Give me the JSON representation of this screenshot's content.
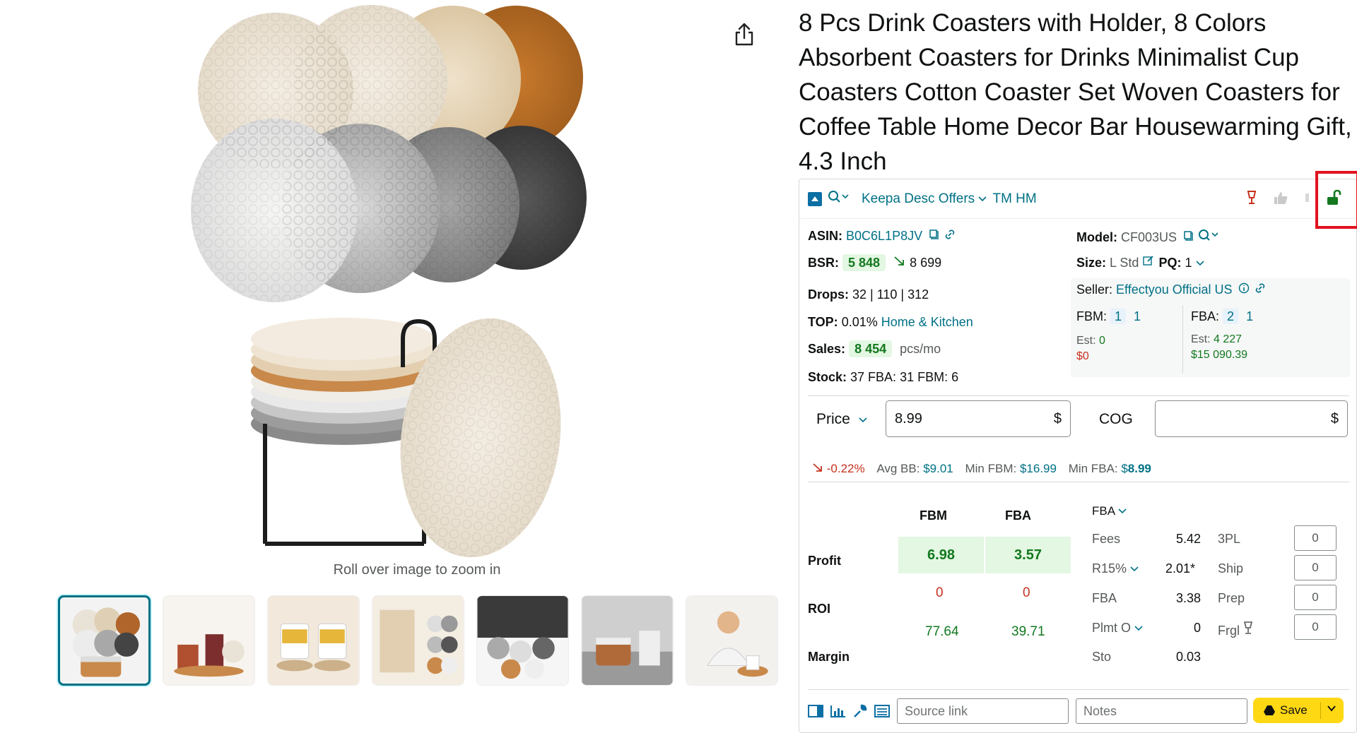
{
  "gallery": {
    "zoom_hint": "Roll over image to zoom in",
    "thumbnail_count": 7
  },
  "product": {
    "title": "8 Pcs Drink Coasters with Holder, 8 Colors Absorbent Coasters for Drinks Minimalist Cup Coasters Cotton Coaster Set Woven Coasters for Coffee Table Home Decor Bar Housewarming Gift, 4.3 Inch"
  },
  "keepa": {
    "toolbar": {
      "menu_label": "Keepa Desc Offers",
      "tm_hm": "TM HM"
    },
    "asin_label": "ASIN:",
    "asin": "B0C6L1P8JV",
    "model_label": "Model:",
    "model": "CF003US",
    "bsr_label": "BSR:",
    "bsr": "5 848",
    "bsr_prev": "8 699",
    "size_label": "Size:",
    "size": "L Std",
    "pq_label": "PQ:",
    "pq": "1",
    "drops_label": "Drops:",
    "drops": "32 | 110 | 312",
    "seller_label": "Seller:",
    "seller": "Effectyou Official US",
    "top_label": "TOP:",
    "top_pct": "0.01%",
    "top_category": "Home & Kitchen",
    "fbm_label": "FBM:",
    "fbm_count_a": "1",
    "fbm_count_b": "1",
    "fba_label": "FBA:",
    "fba_count_a": "2",
    "fba_count_b": "1",
    "sales_label": "Sales:",
    "sales": "8 454",
    "sales_unit": "pcs/mo",
    "est_label": "Est:",
    "fbm_est": "0",
    "fbm_est_money": "$0",
    "fba_est": "4 227",
    "fba_est_money": "$15 090.39",
    "stock_label": "Stock:",
    "stock": "37 FBA: 31 FBM: 6",
    "price_label": "Price",
    "price_value": "8.99",
    "currency": "$",
    "cog_label": "COG",
    "cog_value": "",
    "price_change": "-0.22%",
    "avg_bb_label": "Avg BB:",
    "avg_bb": "$9.01",
    "min_fbm_label": "Min FBM:",
    "min_fbm": "$16.99",
    "min_fba_label": "Min FBA:",
    "min_fba_prefix": "$",
    "min_fba": "8.99",
    "col_fbm": "FBM",
    "col_fba": "FBA",
    "profit_label": "Profit",
    "profit_fbm": "6.98",
    "profit_fba": "3.57",
    "roi_label": "ROI",
    "roi_fbm": "0",
    "roi_fba": "0",
    "margin_label": "Margin",
    "margin_fbm": "77.64",
    "margin_fba": "39.71",
    "fee_mode": "FBA",
    "fees": [
      {
        "label": "Fees",
        "value": "5.42",
        "right_label": "3PL",
        "input": "0"
      },
      {
        "label": "R15%",
        "value": "2.01*",
        "right_label": "Ship",
        "input": "0"
      },
      {
        "label": "FBA",
        "value": "3.38",
        "right_label": "Prep",
        "input": "0"
      },
      {
        "label": "Plmt O",
        "value": "0",
        "right_label": "Frgl",
        "input": "0"
      },
      {
        "label": "Sto",
        "value": "0.03"
      }
    ],
    "source_placeholder": "Source link",
    "notes_placeholder": "Notes",
    "save_label": "Save"
  },
  "colors": {
    "link": "#007185",
    "green": "#13781f",
    "red": "#c7321f",
    "highlight_box": "#e1121f",
    "save_button": "#ffd814"
  }
}
